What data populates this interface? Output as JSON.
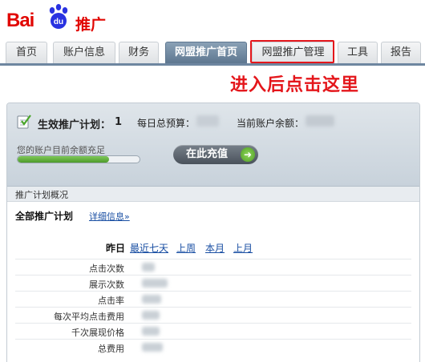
{
  "header": {
    "logo_text": "Bai",
    "logo_paw_text": "du",
    "logo_suffix": "推广"
  },
  "nav": {
    "tabs": [
      {
        "label": "首页",
        "active": false
      },
      {
        "label": "账户信息",
        "active": false
      },
      {
        "label": "财务",
        "active": false
      },
      {
        "label": "网盟推广首页",
        "active": true
      },
      {
        "label": "网盟推广管理",
        "active": false,
        "highlighted": true
      },
      {
        "label": "工具",
        "active": false
      },
      {
        "label": "报告",
        "active": false
      }
    ]
  },
  "annotation": "进入后点击这里",
  "summary": {
    "plan_label": "生效推广计划：",
    "plan_count": "1",
    "budget_label": "每日总预算：",
    "balance_label": "当前账户余额：",
    "account_message": "您的账户目前余额充足",
    "balance_fill": 0.75,
    "recharge_label": "在此充值"
  },
  "overview": {
    "title": "推广计划概况",
    "all_plans": "全部推广计划",
    "details_link": "详细信息»",
    "table": {
      "current_period": "昨日",
      "period_links": [
        "最近七天",
        "上周",
        "本月",
        "上月"
      ],
      "rows": [
        {
          "label": "点击次数"
        },
        {
          "label": "展示次数"
        },
        {
          "label": "点击率"
        },
        {
          "label": "每次平均点击费用"
        },
        {
          "label": "千次展现价格"
        },
        {
          "label": "总费用"
        }
      ]
    }
  },
  "colors": {
    "brand_red": "#e10602",
    "annotation_red": "#e4161b",
    "active_tab": "#5e7790",
    "link_blue": "#1a4fa3",
    "progress_green": "#4d9b2a"
  },
  "icons": {
    "logo": "baidu-paw-icon",
    "plan_status": "checklist-icon",
    "recharge_arrow": "arrow-right-icon"
  }
}
